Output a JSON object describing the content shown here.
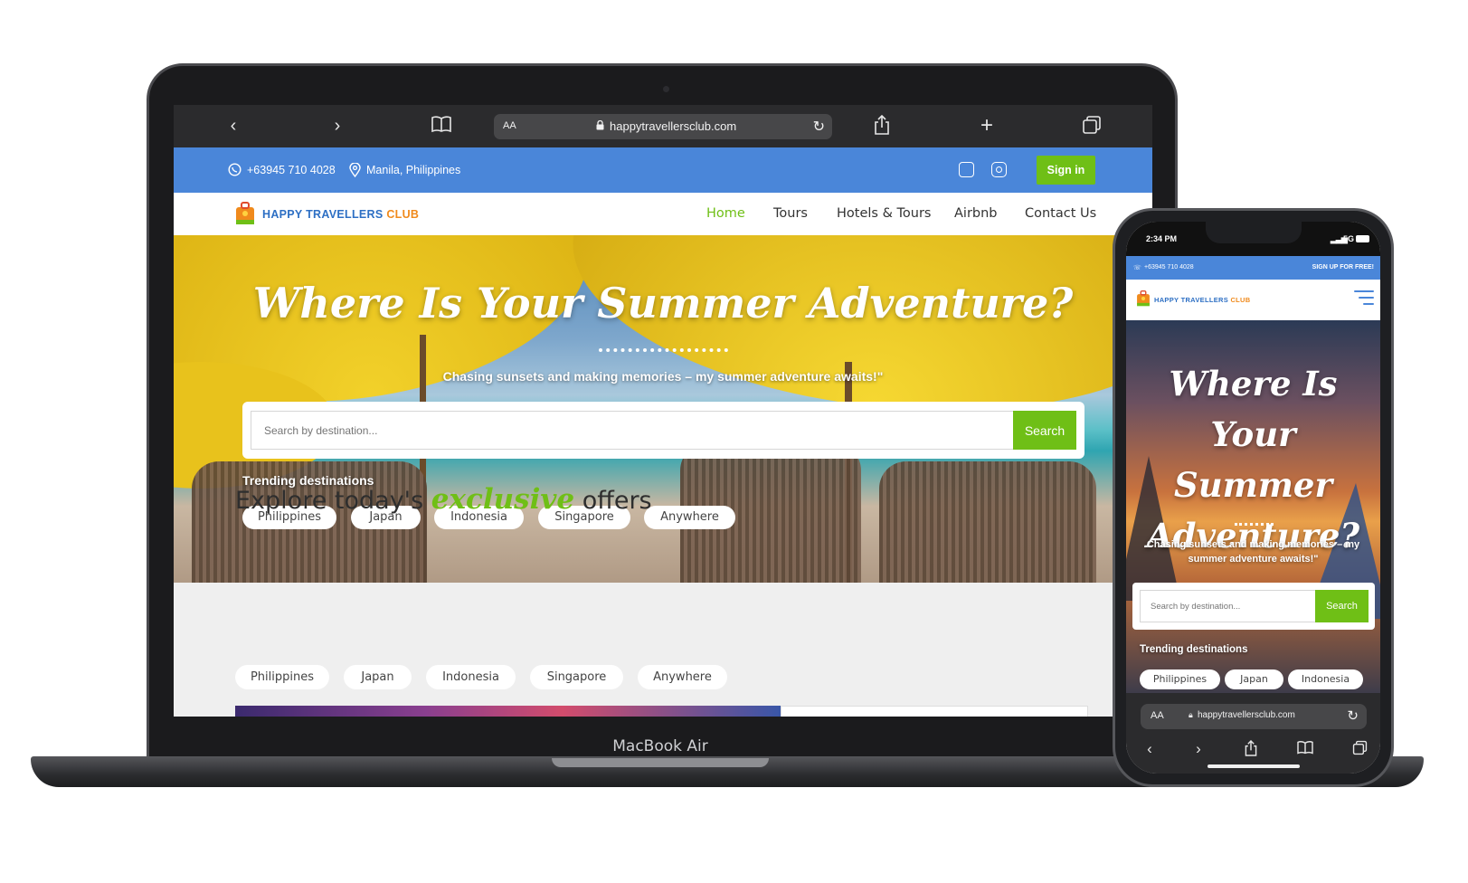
{
  "device_label": "MacBook Air",
  "browser": {
    "aa_label": "AA",
    "url": "happytravellersclub.com"
  },
  "site": {
    "phone_number": "+63945 710 4028",
    "location": "Manila, Philippines",
    "signin_label": "Sign in",
    "logo_primary": "HAPPY TRAVELLERS",
    "logo_secondary": "CLUB",
    "nav": [
      "Home",
      "Tours",
      "Hotels & Tours",
      "Airbnb",
      "Contact Us"
    ],
    "hero_title": "Where Is Your Summer Adventure?",
    "hero_subtitle": "Chasing sunsets and making memories – my summer adventure awaits!\"",
    "search_placeholder": "Search by destination...",
    "search_button": "Search",
    "trending_label": "Trending destinations",
    "trending": [
      "Philippines",
      "Japan",
      "Indonesia",
      "Singapore",
      "Anywhere"
    ],
    "explore_prefix": "Explore today's",
    "explore_accent": "exclusive",
    "explore_suffix": "offers",
    "offer_tabs": [
      "Philippines",
      "Japan",
      "Indonesia",
      "Singapore",
      "Anywhere"
    ]
  },
  "phone": {
    "time": "2:34 PM",
    "network": "5G",
    "phone_number": "+63945 710 4028",
    "signup_label": "SIGN UP FOR FREE!",
    "hero_title_line1": "Where Is Your",
    "hero_title_line2": "Summer",
    "hero_title_line3": "Adventure?",
    "hero_subtitle": "Chasing sunsets and making memories – my summer adventure awaits!\"",
    "search_placeholder": "Search by destination...",
    "search_button": "Search",
    "trending_label": "Trending destinations",
    "trending": [
      "Philippines",
      "Japan",
      "Indonesia"
    ],
    "aa_label": "AA",
    "url": "happytravellersclub.com"
  },
  "colors": {
    "brand_blue": "#4a86d9",
    "brand_green": "#6fbf16",
    "logo_orange": "#f08a1c"
  }
}
